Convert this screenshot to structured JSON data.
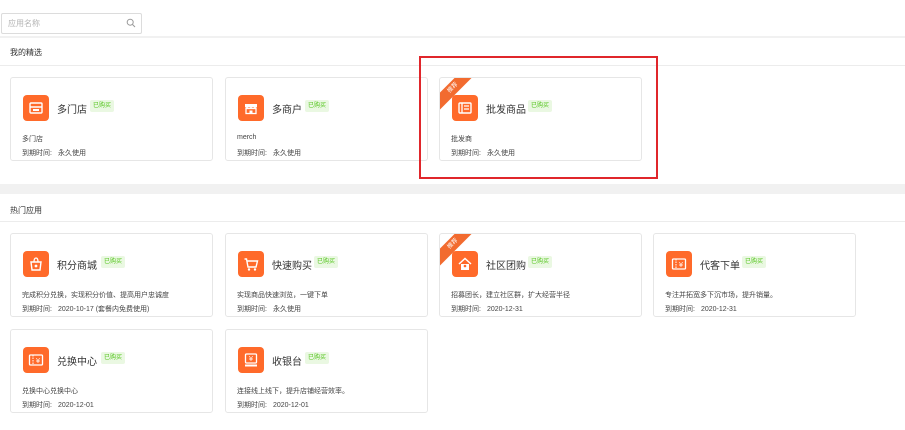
{
  "search": {
    "placeholder": "应用名称",
    "value": ""
  },
  "sections": {
    "my_picks": "我的精选",
    "hot_apps": "热门应用"
  },
  "my_picks": [
    {
      "name": "多门店",
      "badge": "已购买",
      "desc": "多门店",
      "expiry_label": "到期时间:",
      "expiry_value": "永久使用",
      "icon": "store-icon"
    },
    {
      "name": "多商户",
      "badge": "已购买",
      "desc": "merch",
      "expiry_label": "到期时间:",
      "expiry_value": "永久使用",
      "icon": "shop-icon"
    },
    {
      "name": "批发商品",
      "badge": "已购买",
      "desc": "批发商",
      "expiry_label": "到期时间:",
      "expiry_value": "永久使用",
      "icon": "wholesale-icon",
      "ribbon": "推荐"
    }
  ],
  "hot_apps": [
    {
      "name": "积分商城",
      "badge": "已购买",
      "desc": "完成积分兑换，实现积分价值、提高用户忠诚度",
      "expiry_label": "到期时间:",
      "expiry_value": "2020-10-17 (套餐内免费使用)",
      "icon": "points-bag-icon"
    },
    {
      "name": "快速购买",
      "badge": "已购买",
      "desc": "实现商品快速浏览，一键下单",
      "expiry_label": "到期时间:",
      "expiry_value": "永久使用",
      "icon": "cart-icon"
    },
    {
      "name": "社区团购",
      "badge": "已购买",
      "desc": "招募团长，建立社区群，扩大经营半径",
      "expiry_label": "到期时间:",
      "expiry_value": "2020-12-31",
      "icon": "community-icon",
      "ribbon": "推荐"
    },
    {
      "name": "代客下单",
      "badge": "已购买",
      "desc": "专注并拓宽多下沉市场，提升销量。",
      "expiry_label": "到期时间:",
      "expiry_value": "2020-12-31",
      "icon": "ticket-yen-icon"
    },
    {
      "name": "兑换中心",
      "badge": "已购买",
      "desc": "兑换中心兑换中心",
      "expiry_label": "到期时间:",
      "expiry_value": "2020-12-01",
      "icon": "exchange-yen-icon"
    },
    {
      "name": "收银台",
      "badge": "已购买",
      "desc": "连接线上线下，提升店铺经营效率。",
      "expiry_label": "到期时间:",
      "expiry_value": "2020-12-01",
      "icon": "cashier-icon"
    }
  ],
  "colors": {
    "accent": "#ff6a2a",
    "badge_text": "#52c41a",
    "badge_bg": "#eaf8e2",
    "highlight": "#e0262b"
  }
}
